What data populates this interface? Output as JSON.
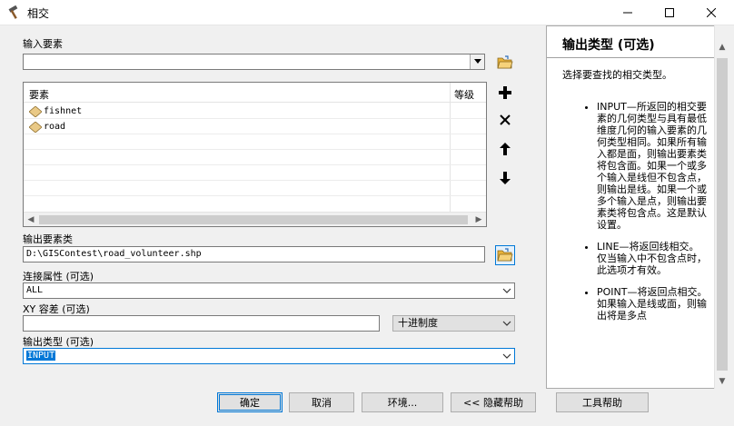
{
  "window": {
    "title": "相交"
  },
  "form": {
    "input_features_label": "输入要素",
    "input_features_value": "",
    "list_header_features": "要素",
    "list_header_rank": "等级",
    "list_items": [
      {
        "name": "fishnet",
        "rank": ""
      },
      {
        "name": "road",
        "rank": ""
      }
    ],
    "output_fc_label": "输出要素类",
    "output_fc_value": "D:\\GISContest\\road_volunteer.shp",
    "join_attr_label": "连接属性 (可选)",
    "join_attr_value": "ALL",
    "xy_tol_label": "XY 容差 (可选)",
    "xy_tol_value": "",
    "xy_tol_unit": "十进制度",
    "output_type_label": "输出类型 (可选)",
    "output_type_value": "INPUT"
  },
  "help": {
    "title": "输出类型 (可选)",
    "description": "选择要查找的相交类型。",
    "items": [
      "INPUT—所返回的相交要素的几何类型与具有最低维度几何的输入要素的几何类型相同。如果所有输入都是面，则输出要素类将包含面。如果一个或多个输入是线但不包含点，则输出是线。如果一个或多个输入是点，则输出要素类将包含点。这是默认设置。",
      "LINE—将返回线相交。仅当输入中不包含点时，此选项才有效。",
      "POINT—将返回点相交。如果输入是线或面，则输出将是多点"
    ]
  },
  "buttons": {
    "ok": "确定",
    "cancel": "取消",
    "environments": "环境...",
    "hide_help": "<< 隐藏帮助",
    "tool_help": "工具帮助"
  },
  "colors": {
    "accent": "#0078d7",
    "folder": "#e8b23a",
    "layer_icon": "#e9c986"
  }
}
